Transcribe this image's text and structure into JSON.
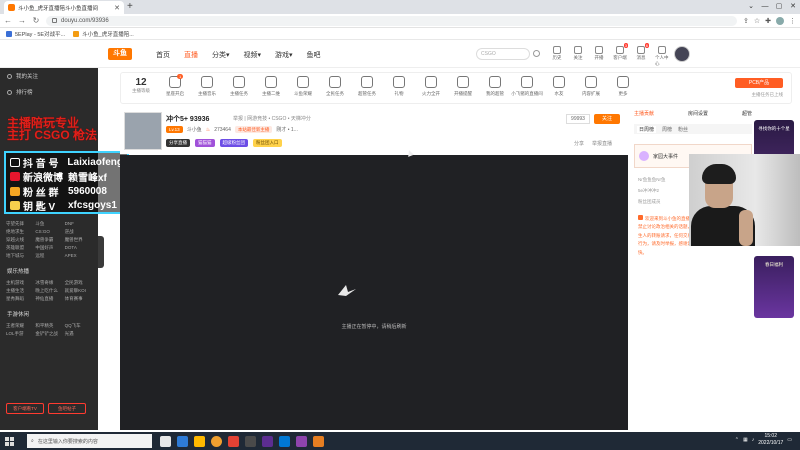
{
  "browser": {
    "tab_title": "斗小鱼_虎牙直播陪斗小鱼直播间",
    "new_tab": "+",
    "url": "douyu.com/93936",
    "window_controls": [
      "⌄",
      "—",
      "▢",
      "✕"
    ],
    "bookmarks": [
      {
        "label": "5EPlay - 5E对战平...",
        "color": "#3b6fd6"
      },
      {
        "label": "斗小鱼_虎牙直播陪...",
        "color": "#f39c12"
      }
    ]
  },
  "site": {
    "logo": "斗鱼",
    "nav": [
      {
        "label": "首页",
        "active": false
      },
      {
        "label": "直播",
        "active": true
      },
      {
        "label": "分类▾",
        "active": false
      },
      {
        "label": "视频▾",
        "active": false
      },
      {
        "label": "游戏▾",
        "active": false
      },
      {
        "label": "鱼吧",
        "active": false
      }
    ],
    "search_placeholder": "CSGO",
    "header_icons": [
      {
        "label": "历史",
        "badge": ""
      },
      {
        "label": "关注",
        "badge": ""
      },
      {
        "label": "开播",
        "badge": ""
      },
      {
        "label": "客户端",
        "badge": "3"
      },
      {
        "label": "消息",
        "badge": "6"
      },
      {
        "label": "个人中心",
        "badge": ""
      }
    ]
  },
  "sidebar": {
    "items": [
      "我的关注",
      "排行榜"
    ],
    "grid1": [
      "守望先锋",
      "斗鱼",
      "DNF",
      "绝地求生",
      "CS:GO",
      "逆战",
      "穿越火线",
      "魔兽争霸",
      "魔兽世界",
      "英雄联盟",
      "中国好声",
      "DOTA",
      "地下城与",
      "远程",
      "APEX"
    ],
    "head2": "娱乐热播",
    "grid2": [
      "主机游戏",
      "冰雪奇缘",
      "全民游戏",
      "主播生活",
      "晚上吃什么",
      "就爱聊KOI",
      "星秀舞蹈",
      "神仙直播",
      "体育赛事"
    ],
    "head3": "手游休闲",
    "grid3": [
      "王者荣耀",
      "和平精英",
      "QQ飞车",
      "LOL手游",
      "金铲铲之战",
      "光遇"
    ],
    "btn_left": "客户端看TV",
    "btn_right": "鱼吧帖子"
  },
  "overlay": {
    "red_lines": [
      "主播陪玩专业",
      "主打 CSGO 枪法"
    ],
    "rows": [
      {
        "key": "抖 音 号",
        "value": "Laixiaofeng",
        "color": "#111"
      },
      {
        "key": "新浪微博",
        "value": "赖雪峰xf",
        "color": "#e6162d"
      },
      {
        "key": "粉 丝 群",
        "value": "5960008",
        "color": "#f5a623"
      },
      {
        "key": "钥 匙 V",
        "value": "xfcsgoys1",
        "color": "#f6d04d"
      }
    ]
  },
  "category_bar": {
    "level": "12",
    "level_label": "主播等级",
    "items": [
      {
        "label": "星座开启",
        "badge": "1"
      },
      {
        "label": "主播音乐",
        "badge": ""
      },
      {
        "label": "主播任务",
        "badge": ""
      },
      {
        "label": "主播二维",
        "badge": ""
      },
      {
        "label": "斗鱼荣耀",
        "badge": ""
      },
      {
        "label": "全民任务",
        "badge": ""
      },
      {
        "label": "超管任务",
        "badge": ""
      },
      {
        "label": "礼物",
        "badge": ""
      },
      {
        "label": "火力全开",
        "badge": ""
      },
      {
        "label": "开播提醒",
        "badge": ""
      },
      {
        "label": "我的超管",
        "badge": ""
      },
      {
        "label": "小飞猪的直播间",
        "badge": ""
      },
      {
        "label": "水友",
        "badge": ""
      },
      {
        "label": "内容扩展",
        "badge": ""
      },
      {
        "label": "更多",
        "badge": ""
      }
    ],
    "pcb": "PCB产品",
    "pcb_sub": "主播任务已上线"
  },
  "streamer": {
    "name": "冲个5+ 93936",
    "meta": "举报  | 网游竞技 • CSGO • 天梯冲分",
    "level_tag": "Lv.13",
    "uid": "斗小鱼",
    "hot": "273464",
    "tag1": "本站最佳新主播",
    "tag2": "刚才 • 1...",
    "fans_btn": "99993",
    "follow_btn": "关注",
    "badges": [
      "分享直播",
      "猫猫猫",
      "超级粉丝团",
      "粉丝团入口"
    ],
    "actions": [
      "分享",
      "举报直播"
    ],
    "thumb_label": "斗鱼ID  斗小鱼"
  },
  "video": {
    "message": "主播正在暂停中，请稍后刷新"
  },
  "right_panel": {
    "tabs": [
      "主播贡献",
      "房间设置",
      "超管"
    ],
    "subtabs": [
      "日周榜",
      "周榜",
      "粉丝"
    ],
    "info_title": "家园大事件",
    "rank_lines": [
      "Nr鱼鱼鱼Nr鱼",
      "5e冲冲冲2",
      "粉丝团成员"
    ],
    "notice": "欢迎来到斗小鱼的直播间，请文明发言，本直播间禁止讨论政治相关的话题，谨防上当受骗，请勿轻信陌生人的转账请求，任何交易请通过官方渠道，如有违规行为，请及时举报，感谢您的支持与配合，祝您观看愉快。"
  },
  "right_edge": {
    "promo_top": "寻找你的十个星",
    "promo_bottom": "春日福利",
    "labels": [
      "小鱼游戏",
      "福利任务"
    ]
  },
  "taskbar": {
    "search_placeholder": "在这里输入你要搜索的内容",
    "apps": [
      "#e8e8e8",
      "#2e7bd6",
      "#ffb900",
      "#f0a030",
      "#e34234",
      "#4a4a4a",
      "#5c2d91",
      "#0078d4",
      "#8e44ad",
      "#e67e22"
    ],
    "time": "15:02",
    "date": "2022/10/17"
  }
}
